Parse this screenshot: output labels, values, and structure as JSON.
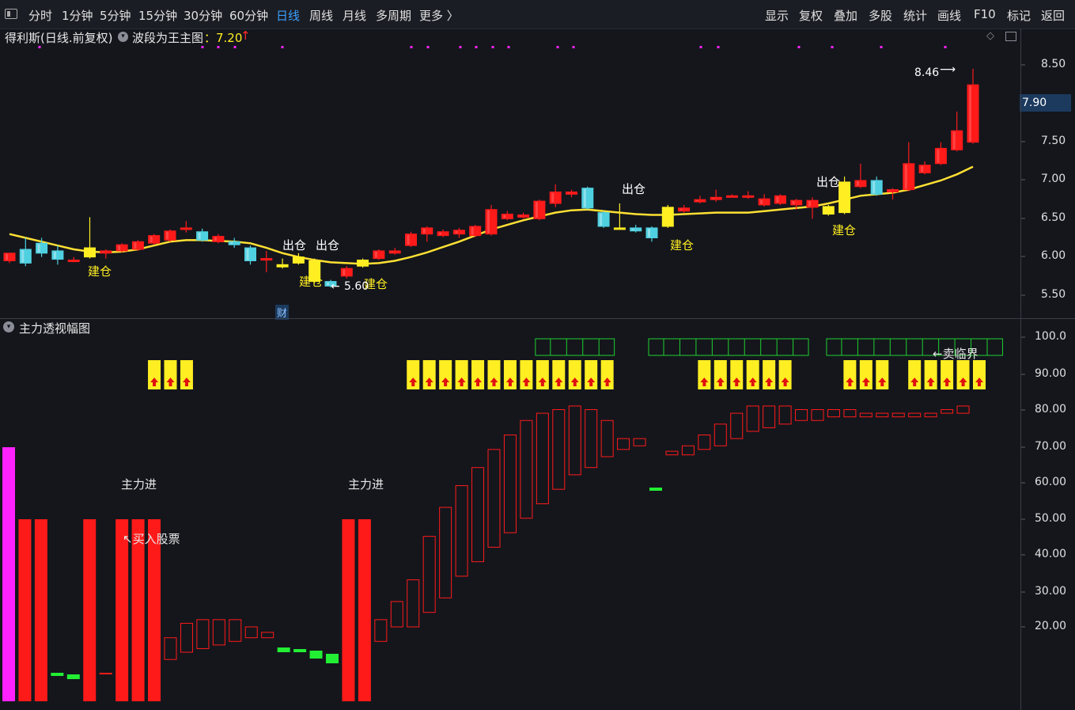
{
  "toolbar": {
    "items": [
      "分时",
      "1分钟",
      "5分钟",
      "15分钟",
      "30分钟",
      "60分钟",
      "日线",
      "周线",
      "月线",
      "多周期",
      "更多 〉"
    ],
    "active_index": 6,
    "right_items": [
      "显示",
      "复权",
      "叠加",
      "多股",
      "统计",
      "画线",
      "F10",
      "标记",
      "返回"
    ]
  },
  "main": {
    "stock_name": "得利斯(日线.前复权)",
    "indicator_name": "波段为王主图",
    "indicator_value": "：7.20",
    "high_label": "8.46",
    "low_label": "5.60",
    "current_price": "7.90",
    "fin_badge": "财",
    "annotations": {
      "open_position": "建仓",
      "close_position": "出仓"
    },
    "y_ticks": [
      "8.50",
      "8.00",
      "7.50",
      "7.00",
      "6.50",
      "6.00",
      "5.50"
    ]
  },
  "sub": {
    "indicator_name": "主力透视幅图",
    "label_main_force_in": "主力进",
    "label_buy": "↖买入股票",
    "label_sell_limit": "←卖临界",
    "y_ticks": [
      "100.0",
      "90.00",
      "80.00",
      "70.00",
      "60.00",
      "50.00",
      "40.00",
      "30.00",
      "20.00"
    ]
  },
  "colors": {
    "up": "#ff1a1a",
    "down": "#4fd0e0",
    "yellow": "#ffee22",
    "ma": "#ffe033",
    "green": "#22ee33",
    "magenta": "#ff22ff",
    "grid": "#3a3d46",
    "active_tab": "#3aa0ff"
  },
  "chart_data": {
    "type": "candlestick",
    "y_range": [
      5.3,
      8.6
    ],
    "candles": [
      {
        "o": 5.95,
        "h": 6.05,
        "l": 5.92,
        "c": 6.05
      },
      {
        "o": 6.1,
        "h": 6.25,
        "l": 5.88,
        "c": 5.92
      },
      {
        "o": 6.18,
        "h": 6.25,
        "l": 6.0,
        "c": 6.05
      },
      {
        "o": 6.08,
        "h": 6.15,
        "l": 5.9,
        "c": 5.97
      },
      {
        "o": 5.95,
        "h": 6.0,
        "l": 5.93,
        "c": 5.96
      },
      {
        "o": 6.0,
        "h": 6.52,
        "l": 5.98,
        "c": 6.12,
        "y": true
      },
      {
        "o": 6.05,
        "h": 6.1,
        "l": 5.98,
        "c": 6.08
      },
      {
        "o": 6.08,
        "h": 6.18,
        "l": 6.06,
        "c": 6.16
      },
      {
        "o": 6.1,
        "h": 6.22,
        "l": 6.08,
        "c": 6.2
      },
      {
        "o": 6.18,
        "h": 6.3,
        "l": 6.16,
        "c": 6.28
      },
      {
        "o": 6.22,
        "h": 6.36,
        "l": 6.2,
        "c": 6.34
      },
      {
        "o": 6.36,
        "h": 6.47,
        "l": 6.32,
        "c": 6.38
      },
      {
        "o": 6.33,
        "h": 6.37,
        "l": 6.2,
        "c": 6.22
      },
      {
        "o": 6.2,
        "h": 6.3,
        "l": 6.18,
        "c": 6.27
      },
      {
        "o": 6.2,
        "h": 6.25,
        "l": 6.12,
        "c": 6.16
      },
      {
        "o": 6.12,
        "h": 6.15,
        "l": 5.9,
        "c": 5.95
      },
      {
        "o": 5.98,
        "h": 6.08,
        "l": 5.8,
        "c": 5.98
      },
      {
        "o": 5.9,
        "h": 5.98,
        "l": 5.85,
        "c": 5.87,
        "y": true
      },
      {
        "o": 5.92,
        "h": 6.05,
        "l": 5.9,
        "c": 6.0,
        "y": true
      },
      {
        "o": 5.95,
        "h": 5.98,
        "l": 5.66,
        "c": 5.68,
        "y": true
      },
      {
        "o": 5.68,
        "h": 5.7,
        "l": 5.6,
        "c": 5.62
      },
      {
        "o": 5.75,
        "h": 5.88,
        "l": 5.72,
        "c": 5.85
      },
      {
        "o": 5.88,
        "h": 5.98,
        "l": 5.86,
        "c": 5.96,
        "y": true
      },
      {
        "o": 5.98,
        "h": 6.1,
        "l": 5.96,
        "c": 6.08
      },
      {
        "o": 6.05,
        "h": 6.12,
        "l": 6.03,
        "c": 6.08
      },
      {
        "o": 6.15,
        "h": 6.33,
        "l": 6.13,
        "c": 6.3
      },
      {
        "o": 6.3,
        "h": 6.4,
        "l": 6.2,
        "c": 6.38
      },
      {
        "o": 6.28,
        "h": 6.36,
        "l": 6.26,
        "c": 6.33
      },
      {
        "o": 6.3,
        "h": 6.38,
        "l": 6.25,
        "c": 6.35
      },
      {
        "o": 6.28,
        "h": 6.42,
        "l": 6.26,
        "c": 6.4
      },
      {
        "o": 6.3,
        "h": 6.68,
        "l": 6.28,
        "c": 6.62
      },
      {
        "o": 6.5,
        "h": 6.6,
        "l": 6.48,
        "c": 6.56
      },
      {
        "o": 6.52,
        "h": 6.58,
        "l": 6.5,
        "c": 6.55
      },
      {
        "o": 6.5,
        "h": 6.75,
        "l": 6.48,
        "c": 6.73
      },
      {
        "o": 6.7,
        "h": 6.95,
        "l": 6.65,
        "c": 6.85
      },
      {
        "o": 6.82,
        "h": 6.88,
        "l": 6.78,
        "c": 6.85
      },
      {
        "o": 6.9,
        "h": 6.92,
        "l": 6.62,
        "c": 6.64
      },
      {
        "o": 6.58,
        "h": 6.6,
        "l": 6.38,
        "c": 6.4
      },
      {
        "o": 6.38,
        "h": 6.7,
        "l": 6.36,
        "c": 6.38,
        "y": true
      },
      {
        "o": 6.38,
        "h": 6.42,
        "l": 6.32,
        "c": 6.34
      },
      {
        "o": 6.38,
        "h": 6.4,
        "l": 6.2,
        "c": 6.25
      },
      {
        "o": 6.4,
        "h": 6.68,
        "l": 6.38,
        "c": 6.65,
        "y": true
      },
      {
        "o": 6.6,
        "h": 6.68,
        "l": 6.58,
        "c": 6.64
      },
      {
        "o": 6.72,
        "h": 6.8,
        "l": 6.7,
        "c": 6.75
      },
      {
        "o": 6.75,
        "h": 6.88,
        "l": 6.72,
        "c": 6.78
      },
      {
        "o": 6.8,
        "h": 6.82,
        "l": 6.78,
        "c": 6.8
      },
      {
        "o": 6.78,
        "h": 6.86,
        "l": 6.76,
        "c": 6.8
      },
      {
        "o": 6.68,
        "h": 6.82,
        "l": 6.66,
        "c": 6.76
      },
      {
        "o": 6.7,
        "h": 6.82,
        "l": 6.68,
        "c": 6.8
      },
      {
        "o": 6.68,
        "h": 6.76,
        "l": 6.62,
        "c": 6.74
      },
      {
        "o": 6.65,
        "h": 6.78,
        "l": 6.5,
        "c": 6.74
      },
      {
        "o": 6.56,
        "h": 6.68,
        "l": 6.54,
        "c": 6.66,
        "y": true
      },
      {
        "o": 6.58,
        "h": 7.05,
        "l": 6.56,
        "c": 6.98,
        "y": true
      },
      {
        "o": 6.92,
        "h": 7.22,
        "l": 6.9,
        "c": 7.0
      },
      {
        "o": 7.0,
        "h": 7.05,
        "l": 6.8,
        "c": 6.82
      },
      {
        "o": 6.85,
        "h": 6.9,
        "l": 6.75,
        "c": 6.88
      },
      {
        "o": 6.88,
        "h": 7.5,
        "l": 6.86,
        "c": 7.22
      },
      {
        "o": 7.1,
        "h": 7.25,
        "l": 7.08,
        "c": 7.2
      },
      {
        "o": 7.22,
        "h": 7.5,
        "l": 7.2,
        "c": 7.42
      },
      {
        "o": 7.4,
        "h": 7.9,
        "l": 7.38,
        "c": 7.65
      },
      {
        "o": 7.5,
        "h": 8.46,
        "l": 7.48,
        "c": 8.25
      }
    ],
    "ma": [
      6.3,
      6.25,
      6.2,
      6.15,
      6.1,
      6.07,
      6.06,
      6.07,
      6.1,
      6.15,
      6.2,
      6.22,
      6.22,
      6.21,
      6.2,
      6.18,
      6.12,
      6.05,
      6.0,
      5.96,
      5.93,
      5.92,
      5.91,
      5.92,
      5.95,
      6.0,
      6.06,
      6.13,
      6.2,
      6.28,
      6.36,
      6.42,
      6.48,
      6.53,
      6.58,
      6.61,
      6.62,
      6.6,
      6.58,
      6.56,
      6.55,
      6.55,
      6.56,
      6.57,
      6.58,
      6.58,
      6.58,
      6.6,
      6.62,
      6.64,
      6.66,
      6.7,
      6.75,
      6.8,
      6.82,
      6.84,
      6.88,
      6.94,
      7.0,
      7.08,
      7.18
    ],
    "sub_y_range": [
      0,
      100
    ],
    "sub_bars": [
      {
        "t": "m",
        "v": 70
      },
      {
        "t": "s",
        "v": 50
      },
      {
        "t": "s",
        "v": 50
      },
      {
        "t": "g",
        "lo": 8,
        "hi": 9
      },
      {
        "t": "g",
        "lo": 7,
        "hi": 8.5
      },
      {
        "t": "s",
        "v": 50
      },
      {
        "t": "r",
        "lo": 8,
        "hi": 9
      },
      {
        "t": "s",
        "v": 50
      },
      {
        "t": "s",
        "v": 50
      },
      {
        "t": "s",
        "v": 50
      },
      {
        "t": "o",
        "lo": 11,
        "hi": 17
      },
      {
        "t": "o",
        "lo": 13,
        "hi": 21
      },
      {
        "t": "o",
        "lo": 14,
        "hi": 22
      },
      {
        "t": "o",
        "lo": 15,
        "hi": 22
      },
      {
        "t": "o",
        "lo": 16,
        "hi": 22
      },
      {
        "t": "o",
        "lo": 17,
        "hi": 20
      },
      {
        "t": "o",
        "lo": 17,
        "hi": 18.5
      },
      {
        "t": "g",
        "lo": 15.5,
        "hi": 17
      },
      {
        "t": "g",
        "lo": 15.5,
        "hi": 16.5
      },
      {
        "t": "g",
        "lo": 13.5,
        "hi": 16
      },
      {
        "t": "g",
        "lo": 12,
        "hi": 15
      },
      {
        "t": "s",
        "v": 50
      },
      {
        "t": "s",
        "v": 50
      },
      {
        "t": "o",
        "lo": 16,
        "hi": 22
      },
      {
        "t": "o",
        "lo": 20,
        "hi": 27
      },
      {
        "t": "o",
        "lo": 20,
        "hi": 33
      },
      {
        "t": "o",
        "lo": 24,
        "hi": 45
      },
      {
        "t": "o",
        "lo": 28,
        "hi": 53
      },
      {
        "t": "o",
        "lo": 34,
        "hi": 59
      },
      {
        "t": "o",
        "lo": 38,
        "hi": 64
      },
      {
        "t": "o",
        "lo": 42,
        "hi": 69
      },
      {
        "t": "o",
        "lo": 46,
        "hi": 73
      },
      {
        "t": "o",
        "lo": 50,
        "hi": 77
      },
      {
        "t": "o",
        "lo": 54,
        "hi": 79
      },
      {
        "t": "o",
        "lo": 58,
        "hi": 80
      },
      {
        "t": "o",
        "lo": 62,
        "hi": 81
      },
      {
        "t": "o",
        "lo": 64,
        "hi": 80
      },
      {
        "t": "o",
        "lo": 67,
        "hi": 77
      },
      {
        "t": "o",
        "lo": 69,
        "hi": 72
      },
      {
        "t": "o",
        "lo": 70,
        "hi": 72
      },
      {
        "t": "g",
        "lo": 66.5,
        "hi": 67.5
      },
      {
        "t": "o",
        "lo": 67.5,
        "hi": 68.5
      },
      {
        "t": "o",
        "lo": 67.5,
        "hi": 70
      },
      {
        "t": "o",
        "lo": 69,
        "hi": 73
      },
      {
        "t": "o",
        "lo": 70,
        "hi": 76
      },
      {
        "t": "o",
        "lo": 72,
        "hi": 79
      },
      {
        "t": "o",
        "lo": 74,
        "hi": 81
      },
      {
        "t": "o",
        "lo": 75,
        "hi": 81
      },
      {
        "t": "o",
        "lo": 76,
        "hi": 81
      },
      {
        "t": "o",
        "lo": 77,
        "hi": 80
      },
      {
        "t": "o",
        "lo": 77,
        "hi": 80
      },
      {
        "t": "o",
        "lo": 78,
        "hi": 80
      },
      {
        "t": "o",
        "lo": 78,
        "hi": 80
      },
      {
        "t": "o",
        "lo": 78,
        "hi": 79
      },
      {
        "t": "o",
        "lo": 78,
        "hi": 79
      },
      {
        "t": "o",
        "lo": 78,
        "hi": 79
      },
      {
        "t": "o",
        "lo": 78,
        "hi": 79
      },
      {
        "t": "o",
        "lo": 78,
        "hi": 79
      },
      {
        "t": "o",
        "lo": 79,
        "hi": 80
      },
      {
        "t": "o",
        "lo": 79,
        "hi": 81
      }
    ],
    "yellow_signals": [
      9,
      10,
      11,
      25,
      26,
      27,
      28,
      29,
      30,
      31,
      32,
      33,
      34,
      35,
      36,
      37,
      43,
      44,
      45,
      46,
      47,
      48,
      52,
      53,
      54,
      56,
      57,
      58,
      59,
      60
    ],
    "green_boxes": [
      [
        33,
        37
      ],
      [
        40,
        49
      ],
      [
        51,
        61
      ]
    ]
  }
}
